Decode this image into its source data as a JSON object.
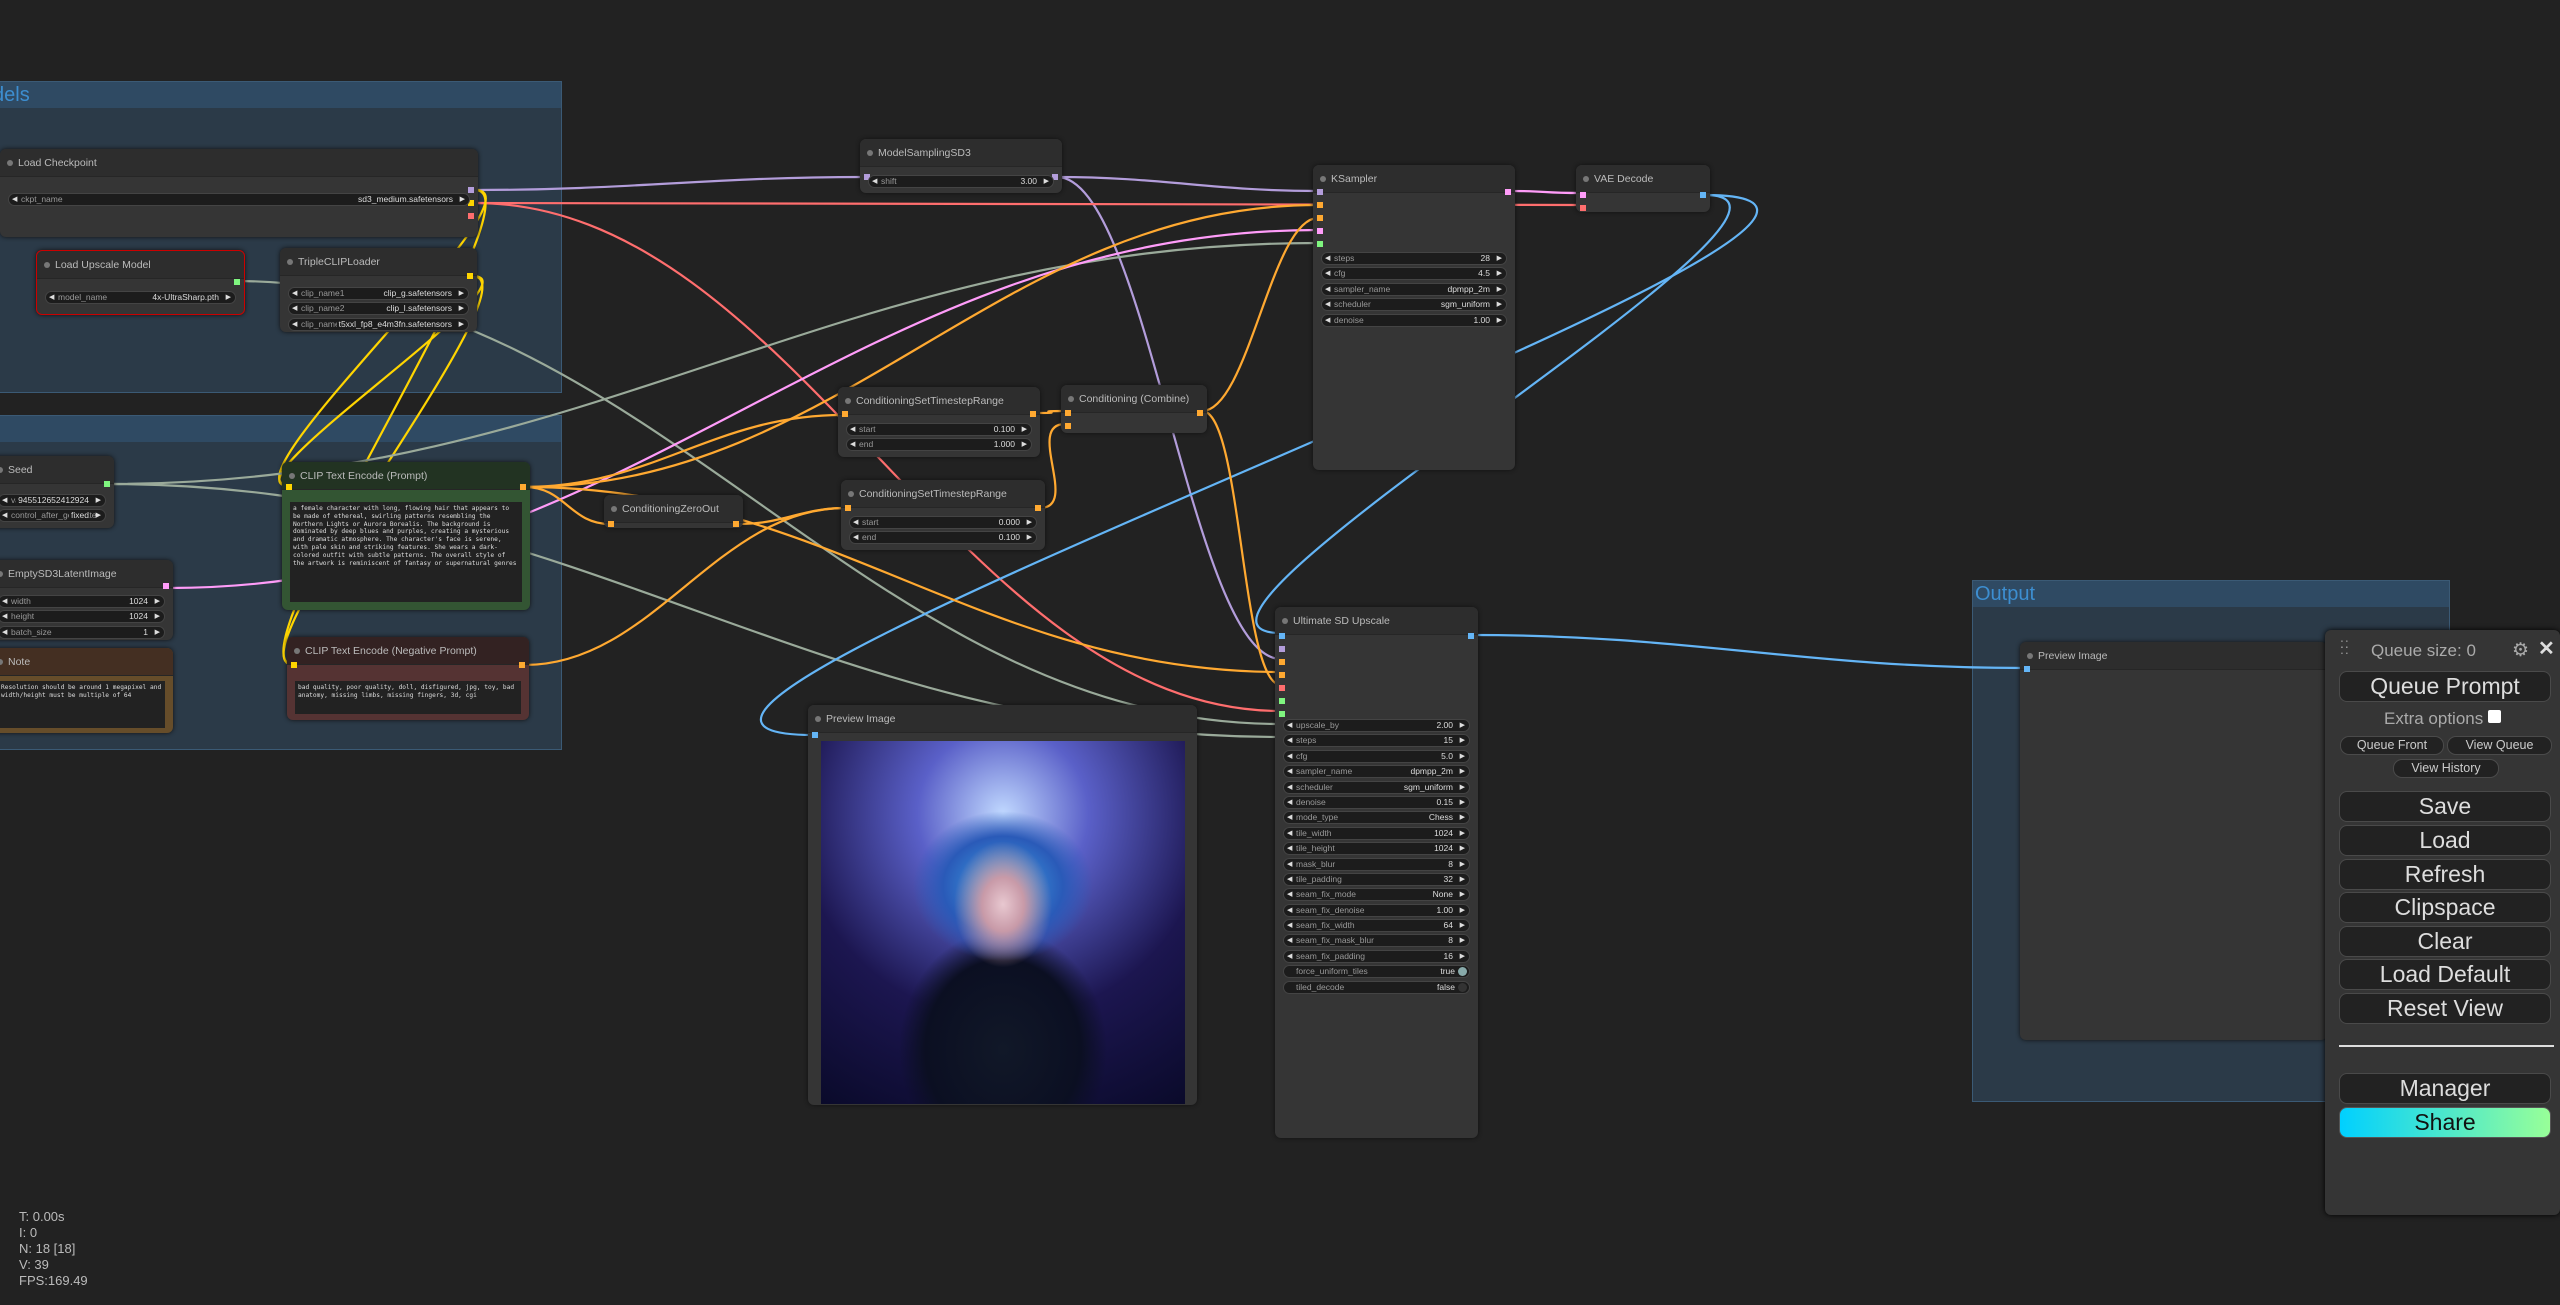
{
  "groups": {
    "models": "dels",
    "output": "Output"
  },
  "nodes": {
    "load_checkpoint": {
      "title": "Load Checkpoint",
      "widgets": [
        {
          "name": "ckpt_name",
          "value": "sd3_medium.safetensors"
        }
      ]
    },
    "load_upscale_model": {
      "title": "Load Upscale Model",
      "widgets": [
        {
          "name": "model_name",
          "value": "4x-UltraSharp.pth"
        }
      ]
    },
    "triple_clip_loader": {
      "title": "TripleCLIPLoader",
      "widgets": [
        {
          "name": "clip_name1",
          "value": "clip_g.safetensors"
        },
        {
          "name": "clip_name2",
          "value": "clip_l.safetensors"
        },
        {
          "name": "clip_name3",
          "value": "t5xxl_fp8_e4m3fn.safetensors"
        }
      ]
    },
    "model_sampling_sd3": {
      "title": "ModelSamplingSD3",
      "widgets": [
        {
          "name": "shift",
          "value": "3.00"
        }
      ]
    },
    "ksampler": {
      "title": "KSampler",
      "widgets": [
        {
          "name": "steps",
          "value": "28"
        },
        {
          "name": "cfg",
          "value": "4.5"
        },
        {
          "name": "sampler_name",
          "value": "dpmpp_2m"
        },
        {
          "name": "scheduler",
          "value": "sgm_uniform"
        },
        {
          "name": "denoise",
          "value": "1.00"
        }
      ]
    },
    "vae_decode": {
      "title": "VAE Decode",
      "widgets": []
    },
    "seed": {
      "title": "Seed",
      "widgets": [
        {
          "name": "value",
          "value": "945512652412924"
        },
        {
          "name": "control_after_generate",
          "value": "fixed"
        }
      ]
    },
    "clip_positive": {
      "title": "CLIP Text Encode (Prompt)",
      "text": "a female character with long, flowing hair that appears to be made of ethereal, swirling patterns resembling the Northern Lights or Aurora Borealis. The background is dominated by deep blues and purples, creating a mysterious and dramatic atmosphere. The character's face is serene, with pale skin and striking features. She wears a dark-colored outfit with subtle patterns. The overall style of the artwork is reminiscent of fantasy or supernatural genres"
    },
    "clip_negative": {
      "title": "CLIP Text Encode (Negative Prompt)",
      "text": "bad quality, poor quality, doll, disfigured, jpg, toy, bad anatomy, missing limbs, missing fingers, 3d, cgi"
    },
    "empty_latent": {
      "title": "EmptySD3LatentImage",
      "widgets": [
        {
          "name": "width",
          "value": "1024"
        },
        {
          "name": "height",
          "value": "1024"
        },
        {
          "name": "batch_size",
          "value": "1"
        }
      ]
    },
    "note": {
      "title": "Note",
      "text": "Resolution should be around 1 megapixel and width/height must be multiple of 64"
    },
    "conditioning_zero_out": {
      "title": "ConditioningZeroOut",
      "widgets": []
    },
    "cond_timestep_1": {
      "title": "ConditioningSetTimestepRange",
      "widgets": [
        {
          "name": "start",
          "value": "0.100"
        },
        {
          "name": "end",
          "value": "1.000"
        }
      ]
    },
    "cond_timestep_2": {
      "title": "ConditioningSetTimestepRange",
      "widgets": [
        {
          "name": "start",
          "value": "0.000"
        },
        {
          "name": "end",
          "value": "0.100"
        }
      ]
    },
    "cond_combine": {
      "title": "Conditioning (Combine)",
      "widgets": []
    },
    "ultimate_sd_upscale": {
      "title": "Ultimate SD Upscale",
      "widgets": [
        {
          "name": "upscale_by",
          "value": "2.00"
        },
        {
          "name": "steps",
          "value": "15"
        },
        {
          "name": "cfg",
          "value": "5.0"
        },
        {
          "name": "sampler_name",
          "value": "dpmpp_2m"
        },
        {
          "name": "scheduler",
          "value": "sgm_uniform"
        },
        {
          "name": "denoise",
          "value": "0.15"
        },
        {
          "name": "mode_type",
          "value": "Chess"
        },
        {
          "name": "tile_width",
          "value": "1024"
        },
        {
          "name": "tile_height",
          "value": "1024"
        },
        {
          "name": "mask_blur",
          "value": "8"
        },
        {
          "name": "tile_padding",
          "value": "32"
        },
        {
          "name": "seam_fix_mode",
          "value": "None"
        },
        {
          "name": "seam_fix_denoise",
          "value": "1.00"
        },
        {
          "name": "seam_fix_width",
          "value": "64"
        },
        {
          "name": "seam_fix_mask_blur",
          "value": "8"
        },
        {
          "name": "seam_fix_padding",
          "value": "16"
        },
        {
          "name": "force_uniform_tiles",
          "value": "true",
          "toggle": true,
          "on": true
        },
        {
          "name": "tiled_decode",
          "value": "false",
          "toggle": true,
          "on": false
        }
      ]
    },
    "preview_image_1": {
      "title": "Preview Image",
      "widgets": []
    },
    "preview_image_2": {
      "title": "Preview Image",
      "widgets": []
    }
  },
  "panel": {
    "queue_size": "Queue size: 0",
    "queue_prompt": "Queue Prompt",
    "extra_options": "Extra options",
    "queue_front": "Queue Front",
    "view_queue": "View Queue",
    "view_history": "View History",
    "save": "Save",
    "load": "Load",
    "refresh": "Refresh",
    "clipspace": "Clipspace",
    "clear": "Clear",
    "load_default": "Load Default",
    "reset_view": "Reset View",
    "manager": "Manager",
    "share": "Share",
    "icons": [
      "drag-handle-icon",
      "gear-icon",
      "close-icon"
    ]
  },
  "stats": {
    "t": "T: 0.00s",
    "i": "I: 0",
    "n": "N: 18 [18]",
    "v": "V: 39",
    "fps": "FPS:169.49"
  },
  "colors": {
    "model": "#b39ddb",
    "clip": "#ffd500",
    "vae": "#ff6e6e",
    "conditioning": "#ffa931",
    "latent": "#ff9cf9",
    "image": "#64b5f6",
    "int": "#7ff57f",
    "upscale_model": "#7ff57f",
    "share_gradient": [
      "#00d0ff",
      "#98ff98"
    ]
  }
}
